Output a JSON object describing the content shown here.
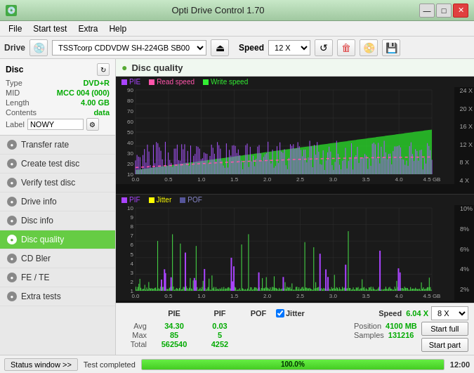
{
  "titleBar": {
    "icon": "💿",
    "title": "Opti Drive Control 1.70",
    "minBtn": "—",
    "maxBtn": "□",
    "closeBtn": "✕"
  },
  "menu": {
    "items": [
      "File",
      "Start test",
      "Extra",
      "Help"
    ]
  },
  "driveBar": {
    "driveLabel": "Drive",
    "driveValue": "(F:)  TSSTcorp CDDVDW SH-224GB SB00",
    "speedLabel": "Speed",
    "speedValue": "12 X"
  },
  "disc": {
    "title": "Disc",
    "type": {
      "key": "Type",
      "val": "DVD+R"
    },
    "mid": {
      "key": "MID",
      "val": "MCC 004 (000)"
    },
    "length": {
      "key": "Length",
      "val": "4.00 GB"
    },
    "contents": {
      "key": "Contents",
      "val": "data"
    },
    "labelKey": "Label",
    "labelVal": "NOWY"
  },
  "navItems": [
    {
      "id": "transfer-rate",
      "label": "Transfer rate",
      "active": false
    },
    {
      "id": "create-test-disc",
      "label": "Create test disc",
      "active": false
    },
    {
      "id": "verify-test-disc",
      "label": "Verify test disc",
      "active": false
    },
    {
      "id": "drive-info",
      "label": "Drive info",
      "active": false
    },
    {
      "id": "disc-info",
      "label": "Disc info",
      "active": false
    },
    {
      "id": "disc-quality",
      "label": "Disc quality",
      "active": true
    },
    {
      "id": "cd-bler",
      "label": "CD Bler",
      "active": false
    },
    {
      "id": "fe-te",
      "label": "FE / TE",
      "active": false
    },
    {
      "id": "extra-tests",
      "label": "Extra tests",
      "active": false
    }
  ],
  "discQuality": {
    "title": "Disc quality",
    "topChart": {
      "legend": [
        {
          "label": "PIE",
          "color": "#aa44ff"
        },
        {
          "label": "Read speed",
          "color": "#ff55aa"
        },
        {
          "label": "Write speed",
          "color": "#33ee33"
        }
      ],
      "yAxisRight": [
        "24 X",
        "20 X",
        "16 X",
        "12 X",
        "8 X",
        "4 X"
      ],
      "yAxisLeft": [
        90,
        80,
        70,
        60,
        50,
        40,
        30,
        20,
        10
      ],
      "xAxis": [
        "0.0",
        "0.5",
        "1.0",
        "1.5",
        "2.0",
        "2.5",
        "3.0",
        "3.5",
        "4.0",
        "4.5 GB"
      ]
    },
    "bottomChart": {
      "legend": [
        {
          "label": "PIF",
          "color": "#aa44ff"
        },
        {
          "label": "Jitter",
          "color": "#ffff00"
        },
        {
          "label": "POF",
          "color": "#555599"
        }
      ],
      "yAxisRight": [
        "10%",
        "8%",
        "6%",
        "4%",
        "2%"
      ],
      "yAxisLeft": [
        10,
        9,
        8,
        7,
        6,
        5,
        4,
        3,
        2,
        1
      ],
      "xAxis": [
        "0.0",
        "0.5",
        "1.0",
        "1.5",
        "2.0",
        "2.5",
        "3.0",
        "3.5",
        "4.0",
        "4.5 GB"
      ]
    }
  },
  "statsArea": {
    "columns": [
      "PIE",
      "PIF",
      "POF",
      "Jitter",
      "Speed",
      "6.04 X"
    ],
    "rows": [
      {
        "label": "Avg",
        "pie": "34.30",
        "pif": "0.03",
        "pof": ""
      },
      {
        "label": "Max",
        "pie": "85",
        "pif": "5",
        "pof": ""
      },
      {
        "label": "Total",
        "pie": "562540",
        "pif": "4252",
        "pof": ""
      }
    ],
    "position": {
      "label": "Position",
      "val": "4100 MB"
    },
    "samples": {
      "label": "Samples",
      "val": "131216"
    },
    "speedCombo": "8 X",
    "startFullBtn": "Start full",
    "startPartBtn": "Start part"
  },
  "statusBar": {
    "statusWindowBtn": "Status window >>",
    "statusText": "Test completed",
    "progressVal": 100,
    "progressText": "100.0%",
    "time": "12:00"
  }
}
